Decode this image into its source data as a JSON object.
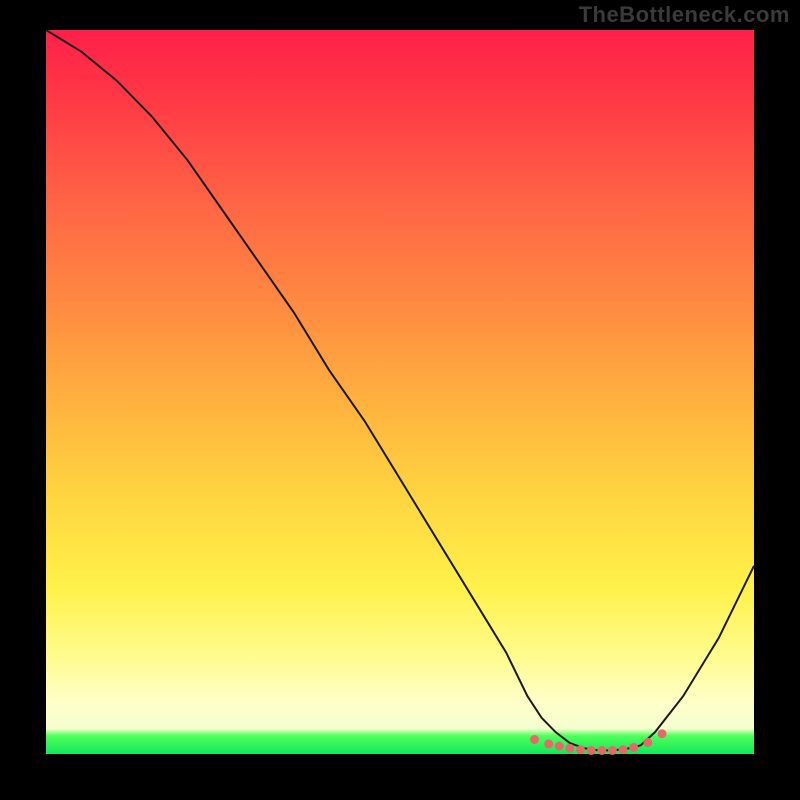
{
  "watermark": "TheBottleneck.com",
  "chart_data": {
    "type": "line",
    "title": "",
    "xlabel": "",
    "ylabel": "",
    "xlim": [
      0,
      100
    ],
    "ylim": [
      0,
      100
    ],
    "grid": false,
    "series": [
      {
        "name": "bottleneck-curve",
        "x": [
          0,
          5,
          10,
          15,
          20,
          25,
          30,
          35,
          40,
          45,
          50,
          55,
          60,
          65,
          68,
          70,
          72,
          74,
          76,
          78,
          80,
          82,
          84,
          86,
          90,
          95,
          100
        ],
        "y": [
          100,
          97,
          93,
          88,
          82,
          75,
          68,
          61,
          53,
          46,
          38,
          30,
          22,
          14,
          8,
          5,
          3,
          1.5,
          0.8,
          0.5,
          0.5,
          0.7,
          1.2,
          3,
          8,
          16,
          26
        ]
      }
    ],
    "markers": {
      "name": "good-zone",
      "x": [
        69,
        71,
        72.5,
        74,
        75.5,
        77,
        78.5,
        80,
        81.5,
        83,
        85,
        87
      ],
      "y": [
        2.0,
        1.4,
        1.1,
        0.8,
        0.6,
        0.5,
        0.5,
        0.5,
        0.6,
        0.9,
        1.6,
        2.8
      ]
    }
  }
}
